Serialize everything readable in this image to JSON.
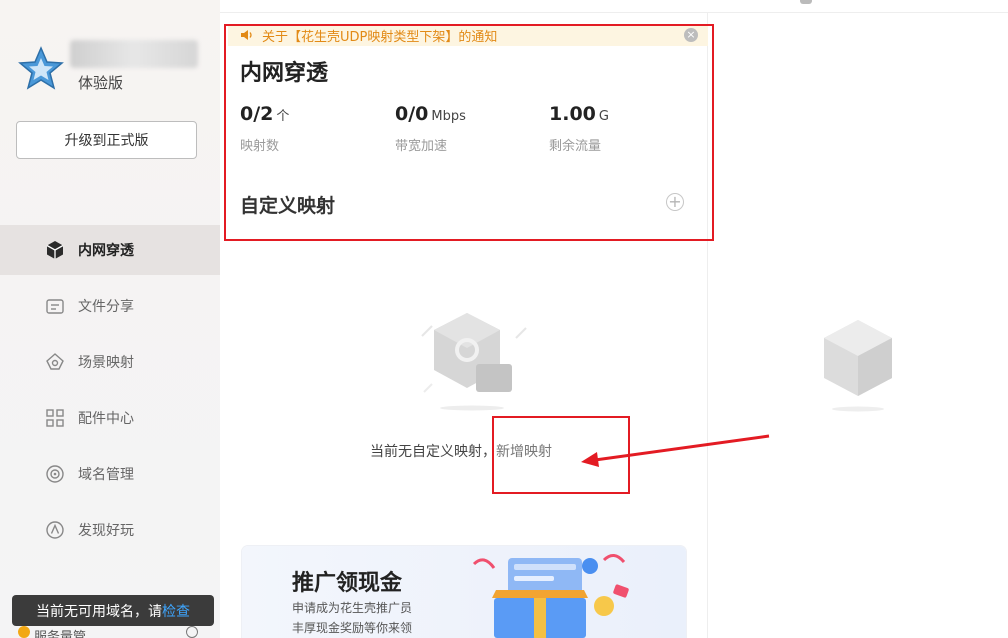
{
  "sidebar": {
    "edition": "体验版",
    "upgrade_label": "升级到正式版",
    "items": [
      {
        "label": "内网穿透",
        "icon": "cube-icon",
        "active": true
      },
      {
        "label": "文件分享",
        "icon": "file-share-icon",
        "active": false
      },
      {
        "label": "场景映射",
        "icon": "scene-map-icon",
        "active": false
      },
      {
        "label": "配件中心",
        "icon": "grid-icon",
        "active": false
      },
      {
        "label": "域名管理",
        "icon": "domain-icon",
        "active": false
      },
      {
        "label": "发现好玩",
        "icon": "discover-icon",
        "active": false
      }
    ],
    "tooltip_text": "当前无可用域名，请",
    "tooltip_link": "检查",
    "bottom_label": "服务量管"
  },
  "main": {
    "notice": "关于【花生壳UDP映射类型下架】的通知",
    "title": "内网穿透",
    "stats": [
      {
        "value": "0/2",
        "unit": "个",
        "label": "映射数"
      },
      {
        "value": "0/0",
        "unit": "Mbps",
        "label": "带宽加速"
      },
      {
        "value": "1.00",
        "unit": "G",
        "label": "剩余流量"
      }
    ],
    "custom_mapping_title": "自定义映射",
    "empty_text": "当前无自定义映射，",
    "add_mapping_link": "新增映射",
    "banner": {
      "title": "推广领现金",
      "line1": "申请成为花生壳推广员",
      "line2": "丰厚现金奖励等你来领"
    }
  },
  "colors": {
    "highlight": "#e31b23",
    "notice_text": "#e28a16",
    "star": "#3e8ed0"
  }
}
